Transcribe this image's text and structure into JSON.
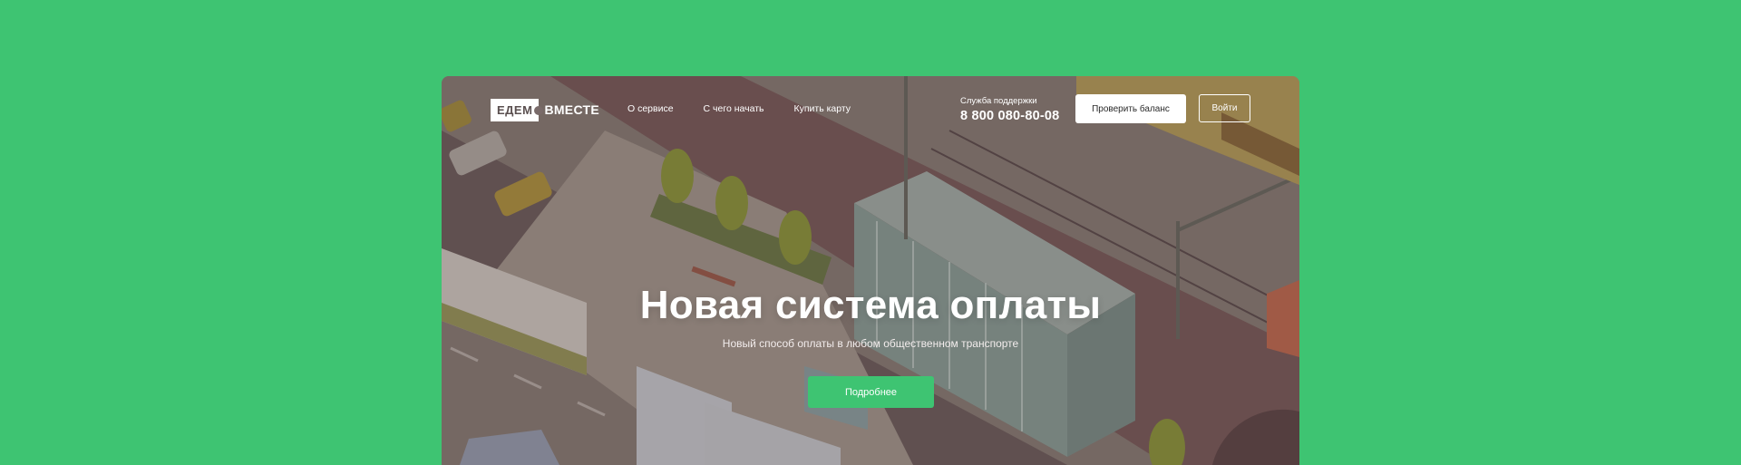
{
  "brand": {
    "logo_box": "ЕДЕМ",
    "logo_text": "ВМЕСТЕ"
  },
  "nav": {
    "items": [
      {
        "label": "О сервисе"
      },
      {
        "label": "С чего начать"
      },
      {
        "label": "Купить карту"
      }
    ]
  },
  "support": {
    "label": "Служба поддержки",
    "phone": "8 800 080-80-08"
  },
  "header_buttons": {
    "balance": "Проверить баланс",
    "login": "Войти"
  },
  "hero": {
    "title": "Новая система оплаты",
    "subtitle": "Новый способ оплаты в любом общественном транспорте",
    "cta": "Подробнее"
  },
  "colors": {
    "page_bg": "#3ec472",
    "accent": "#3ec472"
  }
}
